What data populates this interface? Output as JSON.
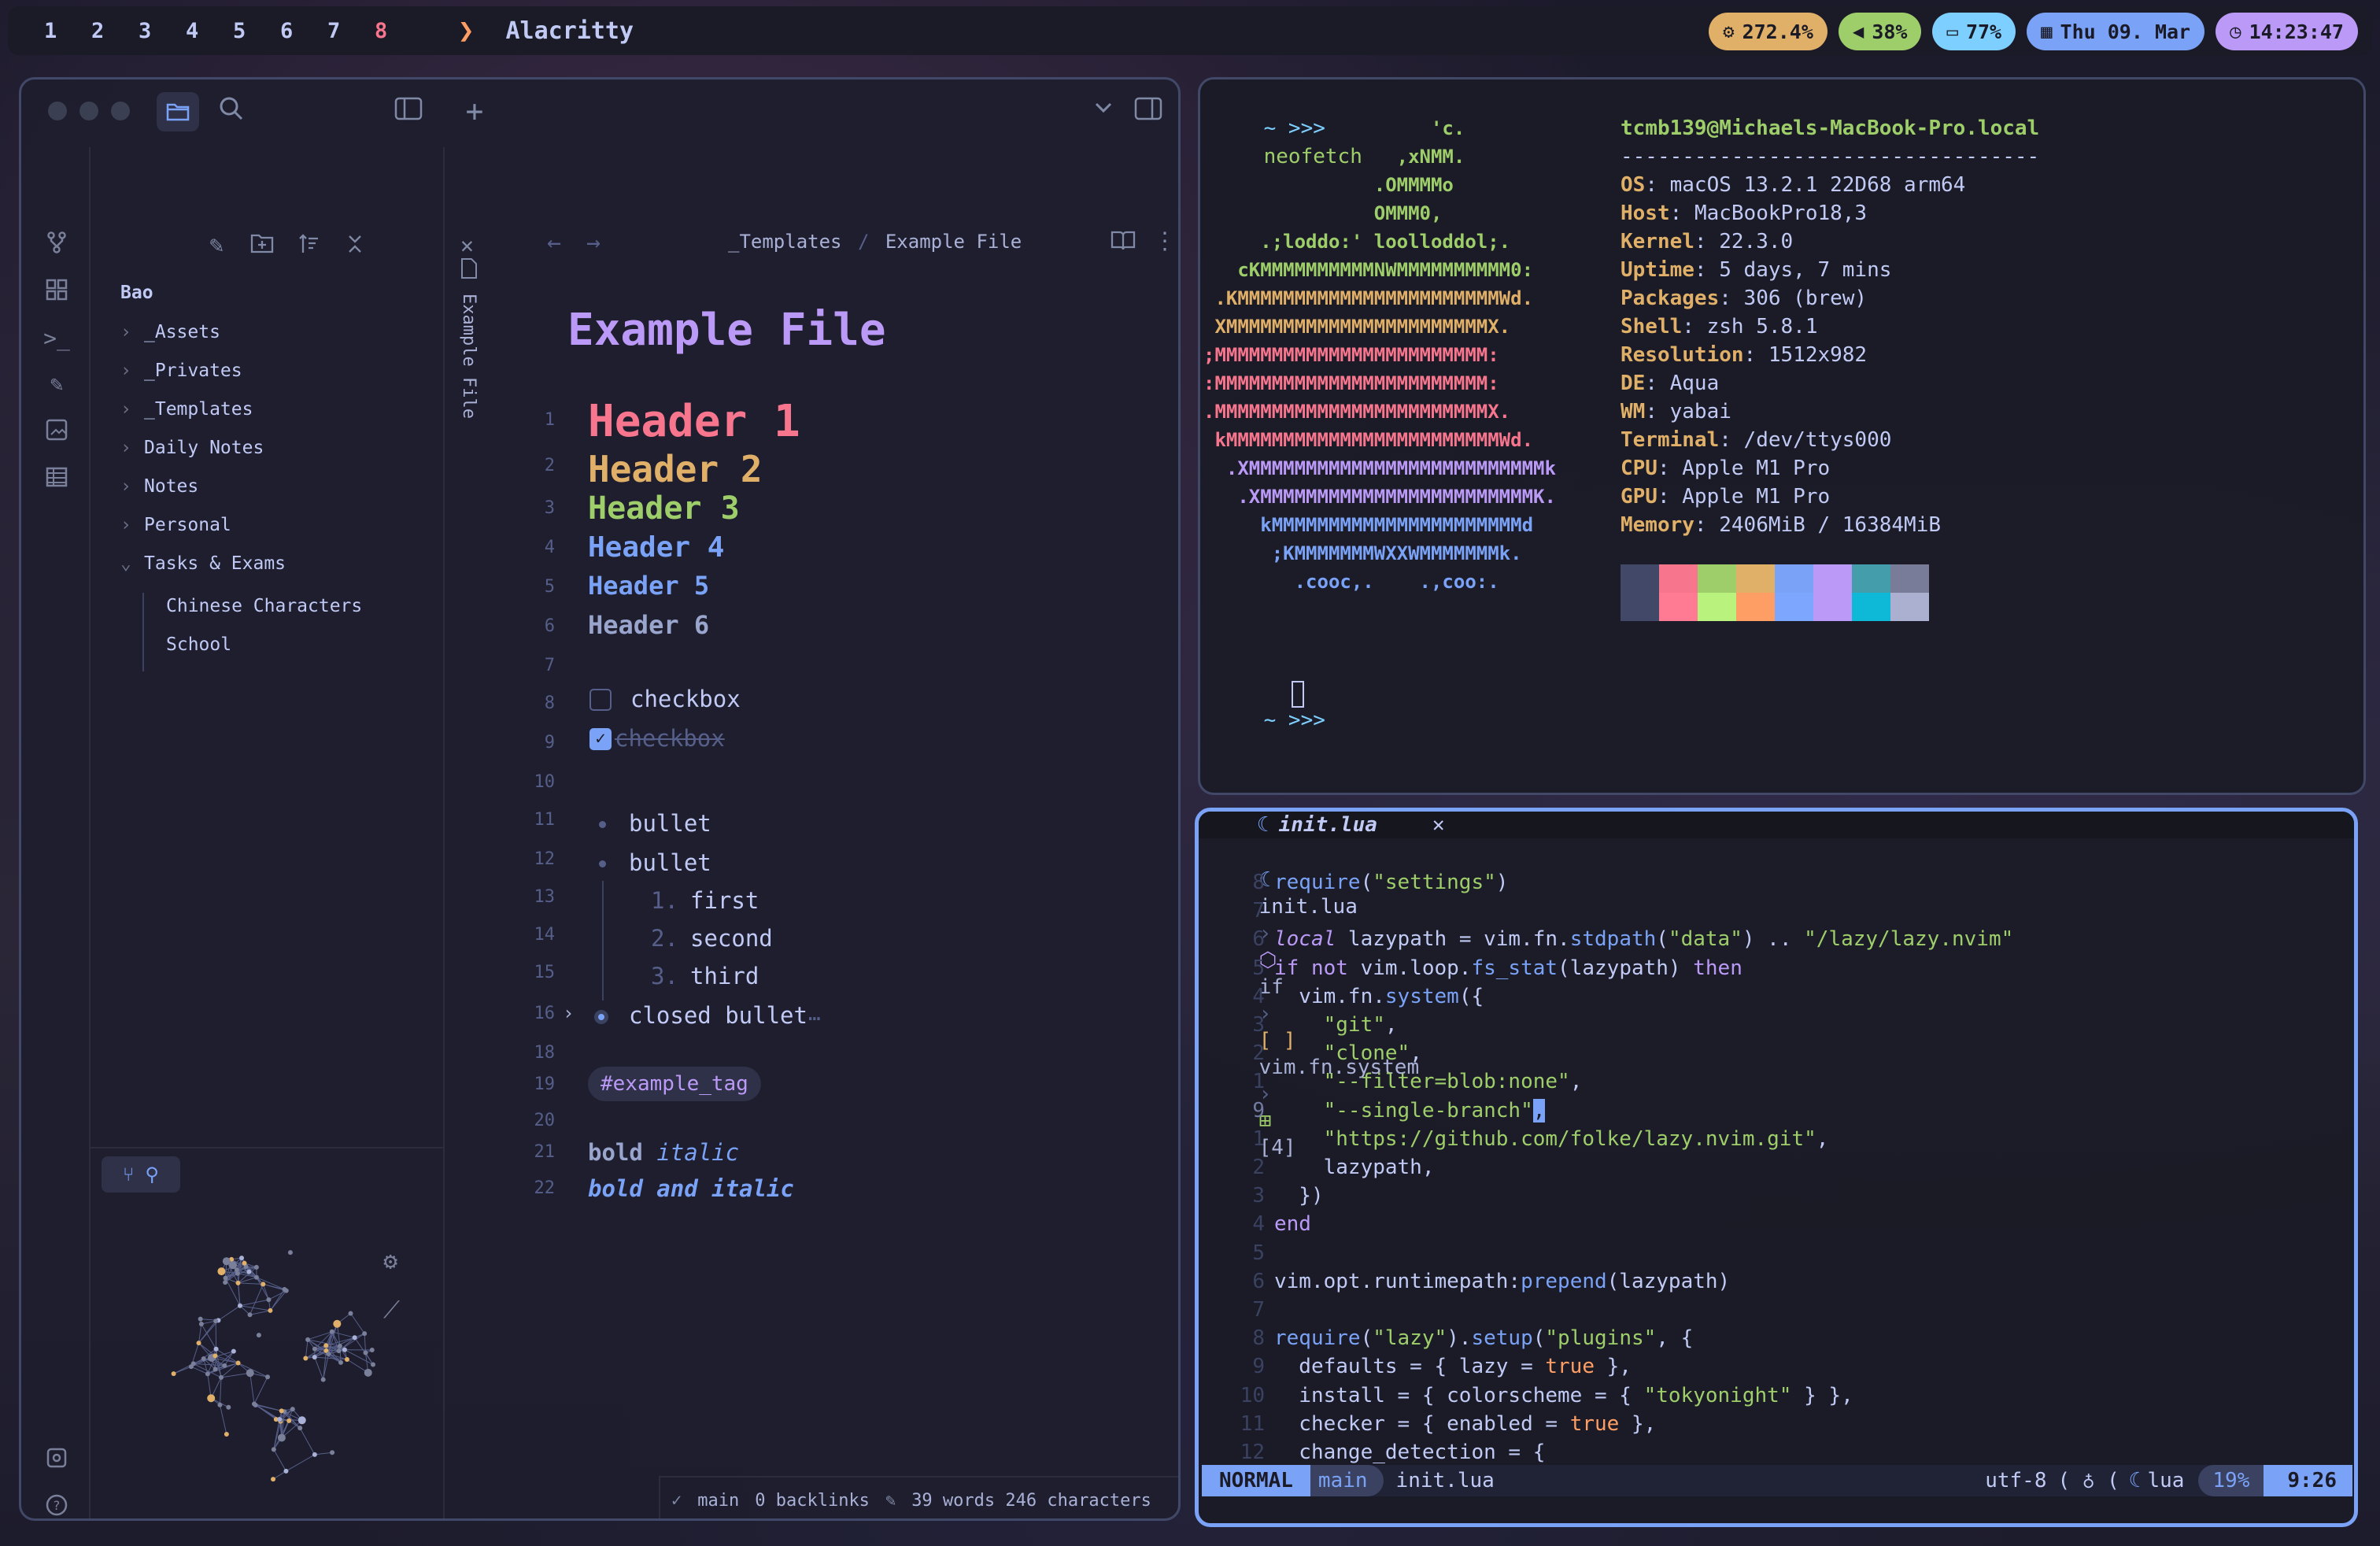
{
  "topbar": {
    "workspaces": [
      "1",
      "2",
      "3",
      "4",
      "5",
      "6",
      "7",
      "8"
    ],
    "active_workspace": "8",
    "app_title": "Alacritty",
    "pills": [
      {
        "icon": "cpu-icon",
        "text": "272.4%",
        "color": "#e0af68"
      },
      {
        "icon": "volume-icon",
        "text": "38%",
        "color": "#9ece6a"
      },
      {
        "icon": "battery-icon",
        "text": "77%",
        "color": "#7dcfff"
      },
      {
        "icon": "calendar-icon",
        "text": "Thu 09. Mar",
        "color": "#7aa2f7"
      },
      {
        "icon": "clock-icon",
        "text": "14:23:47",
        "color": "#bb9af7"
      }
    ]
  },
  "obsidian": {
    "breadcrumb": {
      "folder": "_Templates",
      "sep": "/",
      "file": "Example File"
    },
    "vertical_tab": "Example File",
    "vault_name": "Bao",
    "tree": [
      {
        "label": "_Assets",
        "collapsed": true
      },
      {
        "label": "_Privates",
        "collapsed": true
      },
      {
        "label": "_Templates",
        "collapsed": true
      },
      {
        "label": "Daily Notes",
        "collapsed": true
      },
      {
        "label": "Notes",
        "collapsed": true
      },
      {
        "label": "Personal",
        "collapsed": true
      },
      {
        "label": "Tasks & Exams",
        "collapsed": false
      }
    ],
    "tree_children": [
      "Chinese Characters",
      "School"
    ],
    "note_title": "Example File",
    "lines": {
      "n1": "1",
      "n2": "2",
      "n3": "3",
      "n4": "4",
      "n5": "5",
      "n6": "6",
      "n7": "7",
      "n8": "8",
      "n9": "9",
      "n10": "10",
      "n11": "11",
      "n12": "12",
      "n13": "13",
      "n14": "14",
      "n15": "15",
      "n16": "16",
      "n18": "18",
      "n19": "19",
      "n20": "20",
      "n21": "21",
      "n22": "22"
    },
    "headers": [
      "Header 1",
      "Header 2",
      "Header 3",
      "Header 4",
      "Header 5",
      "Header 6"
    ],
    "checkbox_open": "checkbox",
    "checkbox_done": "checkbox",
    "bullets": [
      "bullet",
      "bullet"
    ],
    "ordered": [
      {
        "n": "1.",
        "t": "first"
      },
      {
        "n": "2.",
        "t": "second"
      },
      {
        "n": "3.",
        "t": "third"
      }
    ],
    "closed_bullet": "closed bullet",
    "ellipsis": "…",
    "tag": "#example_tag",
    "bold1": "bold",
    "italic1": "italic",
    "bold_italic": "bold and italic",
    "status": {
      "branch": "main",
      "backlinks": "0 backlinks",
      "counts": "39 words 246 characters"
    }
  },
  "neofetch": {
    "prompt": "~ >>>",
    "command": "neofetch",
    "art": [
      "                    'c.",
      "                 ,xNMM.",
      "               .OMMMMo",
      "               OMMM0,",
      "     .;loddo:' loolloddol;.",
      "   cKMMMMMMMMMMNWMMMMMMMMMM0:",
      " .KMMMMMMMMMMMMMMMMMMMMMMMWd.",
      " XMMMMMMMMMMMMMMMMMMMMMMMX.",
      ";MMMMMMMMMMMMMMMMMMMMMMMM:",
      ":MMMMMMMMMMMMMMMMMMMMMMMM:",
      ".MMMMMMMMMMMMMMMMMMMMMMMMX.",
      " kMMMMMMMMMMMMMMMMMMMMMMMMWd.",
      "  .XMMMMMMMMMMMMMMMMMMMMMMMMMMk",
      "   .XMMMMMMMMMMMMMMMMMMMMMMMMK.",
      "     kMMMMMMMMMMMMMMMMMMMMMMd",
      "      ;KMMMMMMMWXXWMMMMMMMk.",
      "        .cooc,.    .,coo:."
    ],
    "art_colors": [
      "#9ece6a",
      "#9ece6a",
      "#9ece6a",
      "#9ece6a",
      "#9ece6a",
      "#9ece6a",
      "#e0af68",
      "#e0af68",
      "#f7768e",
      "#f7768e",
      "#f7768e",
      "#f7768e",
      "#bb9af7",
      "#bb9af7",
      "#7aa2f7",
      "#7aa2f7",
      "#7aa2f7"
    ],
    "user_host": "tcmb139@Michaels-MacBook-Pro.local",
    "divider": "----------------------------------",
    "info": [
      {
        "k": "OS",
        "v": "macOS 13.2.1 22D68 arm64"
      },
      {
        "k": "Host",
        "v": "MacBookPro18,3"
      },
      {
        "k": "Kernel",
        "v": "22.3.0"
      },
      {
        "k": "Uptime",
        "v": "5 days, 7 mins"
      },
      {
        "k": "Packages",
        "v": "306 (brew)"
      },
      {
        "k": "Shell",
        "v": "zsh 5.8.1"
      },
      {
        "k": "Resolution",
        "v": "1512x982"
      },
      {
        "k": "DE",
        "v": "Aqua"
      },
      {
        "k": "WM",
        "v": "yabai"
      },
      {
        "k": "Terminal",
        "v": "/dev/ttys000"
      },
      {
        "k": "CPU",
        "v": "Apple M1 Pro"
      },
      {
        "k": "GPU",
        "v": "Apple M1 Pro"
      },
      {
        "k": "Memory",
        "v": "2406MiB / 16384MiB"
      }
    ],
    "colors_top": [
      "#414868",
      "#f7768e",
      "#9ece6a",
      "#e0af68",
      "#7aa2f7",
      "#bb9af7",
      "#449dab",
      "#787c99"
    ],
    "colors_bottom": [
      "#414868",
      "#ff7a93",
      "#b9f27c",
      "#ff9e64",
      "#7da6ff",
      "#bb9af7",
      "#0db9d7",
      "#acb0d0"
    ],
    "prompt2": "~ >>>"
  },
  "nvim": {
    "tab": "init.lua",
    "close": "✕",
    "winbar": [
      "init.lua",
      "if",
      "vim.fn.system",
      "[4]"
    ],
    "lines": [
      {
        "n": "8",
        "segs": [
          [
            "require",
            "#7aa2f7"
          ],
          [
            "(",
            "#c0caf5"
          ],
          [
            "\"settings\"",
            "#9ece6a"
          ],
          [
            ")",
            "#c0caf5"
          ]
        ]
      },
      {
        "n": "7",
        "segs": []
      },
      {
        "n": "6",
        "segs": [
          [
            "local",
            "#bb9af7"
          ],
          [
            " lazypath = vim.fn.",
            "#c0caf5"
          ],
          [
            "stdpath",
            "#7aa2f7"
          ],
          [
            "(",
            "#c0caf5"
          ],
          [
            "\"data\"",
            "#9ece6a"
          ],
          [
            ") .. ",
            "#c0caf5"
          ],
          [
            "\"/lazy/lazy.nvim\"",
            "#9ece6a"
          ]
        ]
      },
      {
        "n": "5",
        "segs": [
          [
            "if not",
            "#bb9af7"
          ],
          [
            " vim.loop.",
            "#c0caf5"
          ],
          [
            "fs_stat",
            "#7aa2f7"
          ],
          [
            "(lazypath) ",
            "#c0caf5"
          ],
          [
            "then",
            "#bb9af7"
          ]
        ]
      },
      {
        "n": "4",
        "segs": [
          [
            "  vim.fn.",
            "#c0caf5"
          ],
          [
            "system",
            "#7aa2f7"
          ],
          [
            "({",
            "#c0caf5"
          ]
        ]
      },
      {
        "n": "3",
        "segs": [
          [
            "    \"git\"",
            "#9ece6a"
          ],
          [
            ",",
            "#c0caf5"
          ]
        ]
      },
      {
        "n": "2",
        "segs": [
          [
            "    \"clone\"",
            "#9ece6a"
          ],
          [
            ",",
            "#c0caf5"
          ]
        ]
      },
      {
        "n": "1",
        "segs": [
          [
            "    \"--filter=blob:none\"",
            "#9ece6a"
          ],
          [
            ",",
            "#c0caf5"
          ]
        ]
      },
      {
        "n": "9",
        "segs": [
          [
            "    \"--single-branch\"",
            "#9ece6a"
          ],
          [
            ",",
            "#1a1b26"
          ]
        ],
        "cursor": true
      },
      {
        "n": "1",
        "segs": [
          [
            "    \"https://github.com/folke/lazy.nvim.git\"",
            "#9ece6a"
          ],
          [
            ",",
            "#c0caf5"
          ]
        ]
      },
      {
        "n": "2",
        "segs": [
          [
            "    lazypath,",
            "#c0caf5"
          ]
        ]
      },
      {
        "n": "3",
        "segs": [
          [
            "  })",
            "#c0caf5"
          ]
        ]
      },
      {
        "n": "4",
        "segs": [
          [
            "end",
            "#bb9af7"
          ]
        ]
      },
      {
        "n": "5",
        "segs": []
      },
      {
        "n": "6",
        "segs": [
          [
            "vim.opt.runtimepath:",
            "#c0caf5"
          ],
          [
            "prepend",
            "#7aa2f7"
          ],
          [
            "(lazypath)",
            "#c0caf5"
          ]
        ]
      },
      {
        "n": "7",
        "segs": []
      },
      {
        "n": "8",
        "segs": [
          [
            "require",
            "#7aa2f7"
          ],
          [
            "(",
            "#c0caf5"
          ],
          [
            "\"lazy\"",
            "#9ece6a"
          ],
          [
            ").",
            "#c0caf5"
          ],
          [
            "setup",
            "#7aa2f7"
          ],
          [
            "(",
            "#c0caf5"
          ],
          [
            "\"plugins\"",
            "#9ece6a"
          ],
          [
            ", {",
            "#c0caf5"
          ]
        ]
      },
      {
        "n": "9",
        "segs": [
          [
            "  defaults = { lazy = ",
            "#c0caf5"
          ],
          [
            "true",
            "#ff9e64"
          ],
          [
            " },",
            "#c0caf5"
          ]
        ]
      },
      {
        "n": "10",
        "segs": [
          [
            "  install = { colorscheme = { ",
            "#c0caf5"
          ],
          [
            "\"tokyonight\"",
            "#9ece6a"
          ],
          [
            " } },",
            "#c0caf5"
          ]
        ]
      },
      {
        "n": "11",
        "segs": [
          [
            "  checker = { enabled = ",
            "#c0caf5"
          ],
          [
            "true",
            "#ff9e64"
          ],
          [
            " },",
            "#c0caf5"
          ]
        ]
      },
      {
        "n": "12",
        "segs": [
          [
            "  change_detection = {",
            "#c0caf5"
          ]
        ]
      }
    ],
    "statusline": {
      "mode": "NORMAL",
      "branch": "main",
      "file": "init.lua",
      "encoding": "utf-8",
      "filetype": "lua",
      "percent": "19%",
      "position": "9:26"
    }
  }
}
